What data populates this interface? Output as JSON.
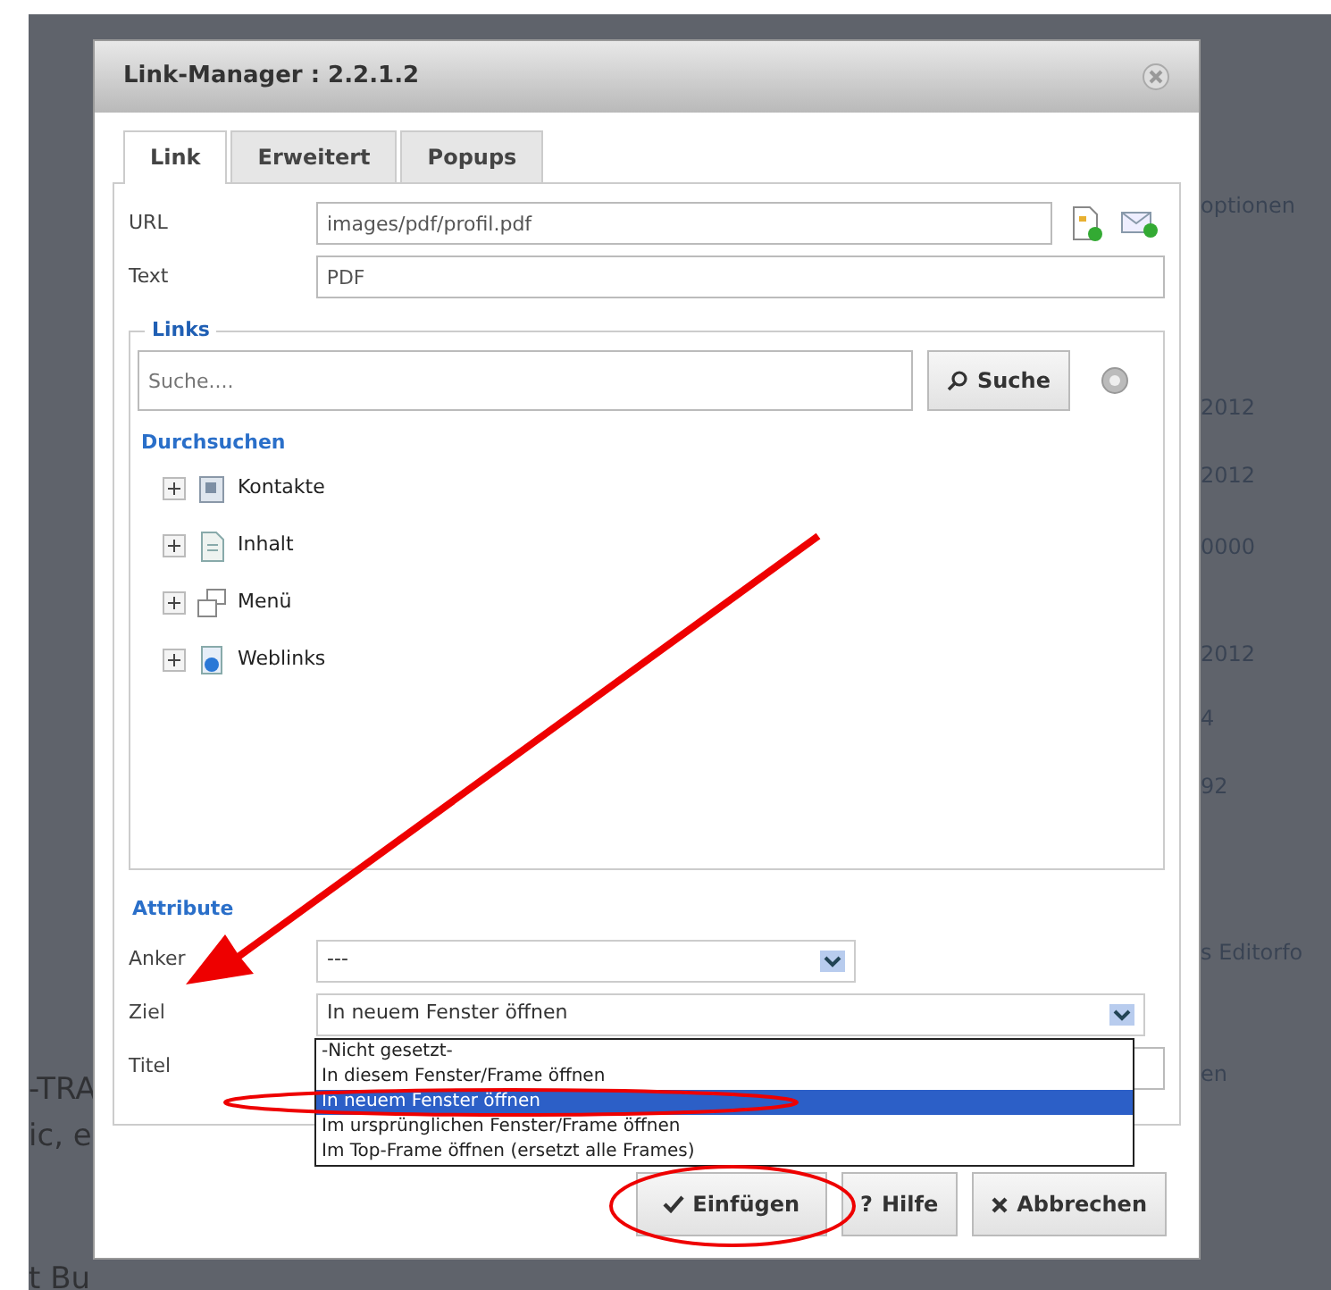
{
  "background": {
    "right_texts": [
      "optionen",
      "2012",
      "2012",
      "0000",
      "2012",
      "4",
      "92",
      "s Editorfo",
      "en"
    ],
    "left_texts": [
      "-TRA",
      "ic, e",
      "t Bu"
    ]
  },
  "dialog": {
    "title": "Link-Manager : 2.2.1.2"
  },
  "tabs": [
    {
      "label": "Link",
      "selected": true
    },
    {
      "label": "Erweitert",
      "selected": false
    },
    {
      "label": "Popups",
      "selected": false
    }
  ],
  "fields": [
    {
      "label": "URL",
      "value": "images/pdf/profil.pdf"
    },
    {
      "label": "Text",
      "value": "PDF"
    }
  ],
  "links": {
    "legend": "Links",
    "search_placeholder": "Suche....",
    "search_button": "Suche",
    "browse_heading": "Durchsuchen",
    "tree": [
      {
        "label": "Kontakte",
        "kind": "contacts",
        "expanded": false
      },
      {
        "label": "Inhalt",
        "kind": "content",
        "expanded": false
      },
      {
        "label": "Menü",
        "kind": "menu",
        "expanded": false
      },
      {
        "label": "Weblinks",
        "kind": "weblinks",
        "expanded": false
      }
    ]
  },
  "attributes": {
    "heading": "Attribute",
    "anchor": {
      "label": "Anker",
      "value": "---"
    },
    "target": {
      "label": "Ziel",
      "value": "In neuem Fenster öffnen",
      "expanded": true,
      "options": [
        {
          "label": "-Nicht gesetzt-",
          "selected": false
        },
        {
          "label": "In diesem Fenster/Frame öffnen",
          "selected": false
        },
        {
          "label": "In neuem Fenster öffnen",
          "selected": true
        },
        {
          "label": "Im ursprünglichen Fenster/Frame öffnen",
          "selected": false
        },
        {
          "label": "Im Top-Frame öffnen (ersetzt alle Frames)",
          "selected": false
        }
      ]
    },
    "title": {
      "label": "Titel"
    }
  },
  "buttons": [
    {
      "kind": "insert",
      "label": "Einfügen"
    },
    {
      "kind": "help",
      "label": "Hilfe",
      "icon": "?"
    },
    {
      "kind": "cancel",
      "label": "Abbrechen"
    }
  ]
}
